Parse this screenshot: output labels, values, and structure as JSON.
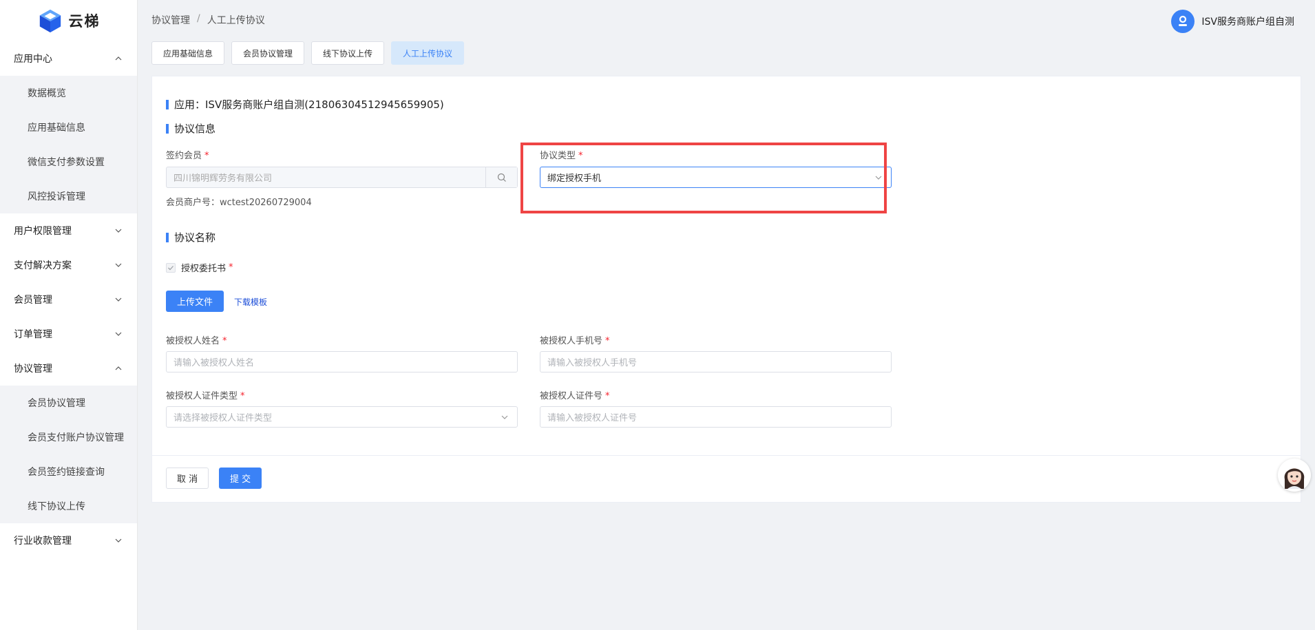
{
  "brand": {
    "name": "云梯",
    "logo_icon": "cube-logo-icon"
  },
  "sidebar": {
    "groups": [
      {
        "label": "应用中心",
        "expanded": true,
        "items": [
          "数据概览",
          "应用基础信息",
          "微信支付参数设置",
          "风控投诉管理"
        ]
      },
      {
        "label": "用户权限管理",
        "expanded": false
      },
      {
        "label": "支付解决方案",
        "expanded": false
      },
      {
        "label": "会员管理",
        "expanded": false
      },
      {
        "label": "订单管理",
        "expanded": false
      },
      {
        "label": "协议管理",
        "expanded": true,
        "items": [
          "会员协议管理",
          "会员支付账户协议管理",
          "会员签约链接查询",
          "线下协议上传"
        ]
      },
      {
        "label": "行业收款管理",
        "expanded": false
      }
    ]
  },
  "header": {
    "breadcrumb": [
      "协议管理",
      "人工上传协议"
    ],
    "breadcrumb_sep": "/",
    "user_name": "ISV服务商账户组自测"
  },
  "tabs": [
    {
      "label": "应用基础信息",
      "active": false
    },
    {
      "label": "会员协议管理",
      "active": false
    },
    {
      "label": "线下协议上传",
      "active": false
    },
    {
      "label": "人工上传协议",
      "active": true
    }
  ],
  "form": {
    "app_title": "应用：ISV服务商账户组自测(21806304512945659905)",
    "section_info": "协议信息",
    "member_label": "签约会员",
    "member_value": "四川锦明辉劳务有限公司",
    "merchant_no": "会员商户号：wctest20260729004",
    "type_label": "协议类型",
    "type_value": "绑定授权手机",
    "section_name": "协议名称",
    "checkbox_label": "授权委托书",
    "upload_label": "上传文件",
    "download_label": "下载模板",
    "name_label": "被授权人姓名",
    "name_placeholder": "请输入被授权人姓名",
    "phone_label": "被授权人手机号",
    "phone_placeholder": "请输入被授权人手机号",
    "id_type_label": "被授权人证件类型",
    "id_type_placeholder": "请选择被授权人证件类型",
    "id_no_label": "被授权人证件号",
    "id_no_placeholder": "请输入被授权人证件号",
    "required_mark": "*",
    "cancel_label": "取 消",
    "submit_label": "提 交"
  },
  "colors": {
    "primary": "#3b82f6",
    "highlight": "#ef4444",
    "required": "#f5222d"
  }
}
